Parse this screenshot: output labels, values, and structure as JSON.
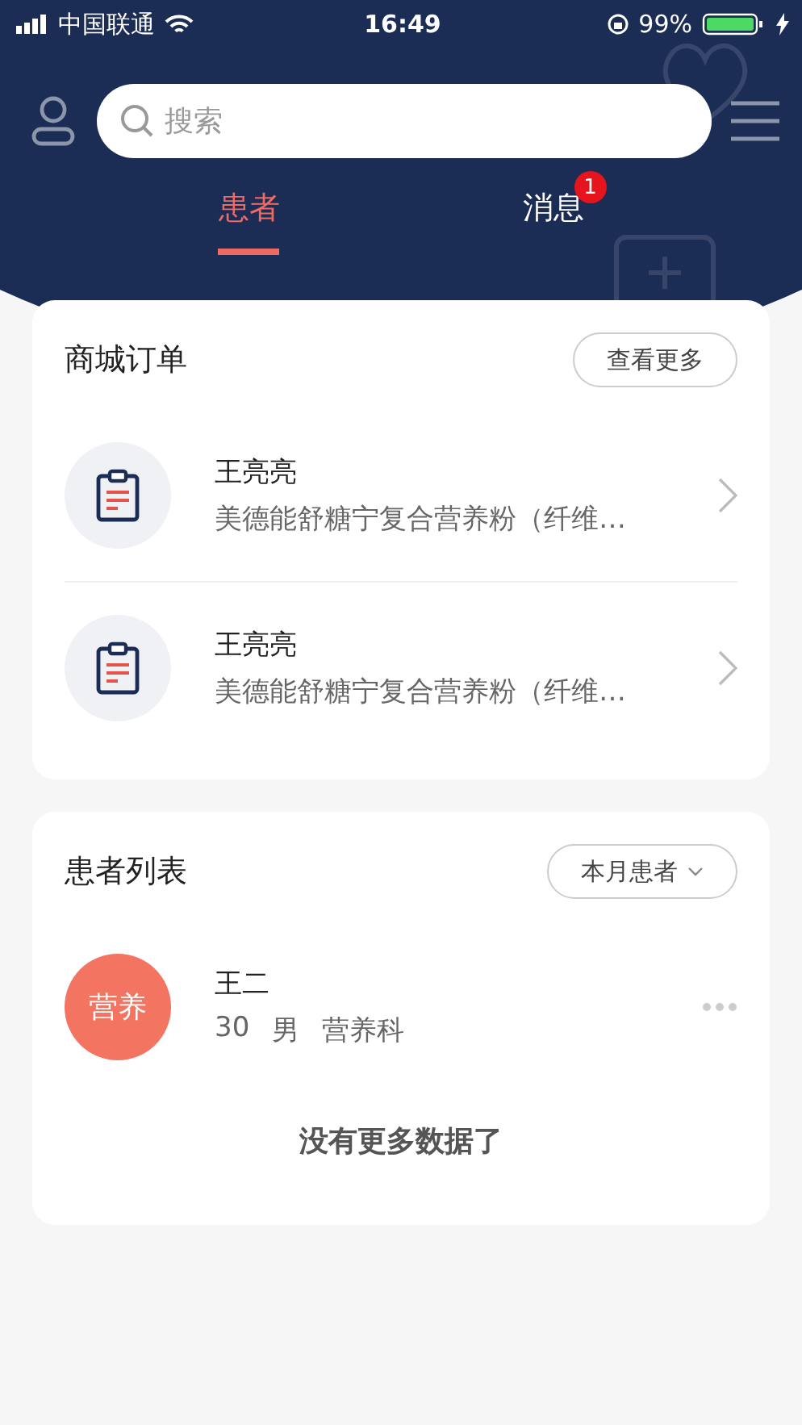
{
  "status_bar": {
    "carrier": "中国联通",
    "time": "16:49",
    "battery": "99%"
  },
  "search": {
    "placeholder": "搜索"
  },
  "tabs": [
    {
      "label": "患者",
      "selected": true
    },
    {
      "label": "消息",
      "selected": false,
      "badge": "1"
    }
  ],
  "orders": {
    "title": "商城订单",
    "more_button": "查看更多",
    "items": [
      {
        "name": "王亮亮",
        "product": "美德能舒糖宁复合营养粉（纤维…"
      },
      {
        "name": "王亮亮",
        "product": "美德能舒糖宁复合营养粉（纤维…"
      }
    ]
  },
  "patients": {
    "title": "患者列表",
    "filter": "本月患者",
    "items": [
      {
        "avatar": "营养",
        "name": "王二",
        "age": "30",
        "gender": "男",
        "department": "营养科"
      }
    ],
    "footer": "没有更多数据了"
  }
}
